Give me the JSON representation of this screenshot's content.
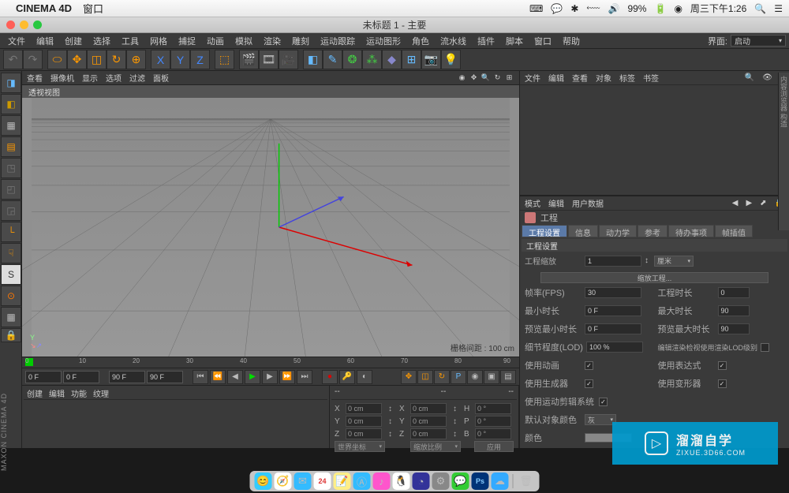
{
  "mac": {
    "app_name": "CINEMA 4D",
    "menus": [
      "窗口"
    ],
    "battery": "99%",
    "clock": "周三下午1:26"
  },
  "doc_title": "未标题 1 - 主要",
  "app_menus": [
    "文件",
    "编辑",
    "创建",
    "选择",
    "工具",
    "网格",
    "捕捉",
    "动画",
    "模拟",
    "渲染",
    "雕刻",
    "运动跟踪",
    "运动图形",
    "角色",
    "流水线",
    "插件",
    "脚本",
    "窗口",
    "帮助"
  ],
  "layout": {
    "label": "界面:",
    "value": "启动"
  },
  "viewport": {
    "menus": [
      "查看",
      "摄像机",
      "显示",
      "选项",
      "过滤",
      "面板"
    ],
    "label": "透视视图",
    "grid_dist": "栅格间距 : 100 cm",
    "axis_cube": "Y"
  },
  "timeline": {
    "ticks": [
      "0",
      "10",
      "20",
      "30",
      "40",
      "50",
      "60",
      "70",
      "80",
      "90"
    ],
    "fields": {
      "start": "0 F",
      "cur": "0 F",
      "preview_end": "90 F",
      "end": "90 F"
    }
  },
  "bottom": {
    "left_tabs": [
      "创建",
      "编辑",
      "功能",
      "纹理"
    ],
    "dash": "--",
    "coords": {
      "x": {
        "lbl": "X",
        "pos": "0 cm",
        "slbl": "X",
        "size": "0 cm",
        "hlbl": "H",
        "rot": "0 °"
      },
      "y": {
        "lbl": "Y",
        "pos": "0 cm",
        "slbl": "Y",
        "size": "0 cm",
        "plbl": "P",
        "rot": "0 °"
      },
      "z": {
        "lbl": "Z",
        "pos": "0 cm",
        "slbl": "Z",
        "size": "0 cm",
        "blbl": "B",
        "rot": "0 °"
      },
      "mode1": "世界坐标",
      "mode2": "缩放比例",
      "apply": "应用"
    }
  },
  "obj_panel": {
    "menus": [
      "文件",
      "编辑",
      "查看",
      "对象",
      "标签",
      "书签"
    ]
  },
  "attr_panel": {
    "menus": [
      "模式",
      "编辑",
      "用户数据"
    ],
    "title": "工程",
    "tabs": [
      "工程设置",
      "信息",
      "动力学",
      "参考",
      "待办事项",
      "帧插值"
    ],
    "section": "工程设置",
    "scale_lbl": "工程缩放",
    "scale_val": "1",
    "scale_unit": "厘米",
    "scale_btn": "缩放工程...",
    "fps_lbl": "帧率(FPS)",
    "fps_val": "30",
    "proj_time_lbl": "工程时长",
    "proj_time_val": "0",
    "min_time_lbl": "最小时长",
    "min_time_val": "0 F",
    "max_time_lbl": "最大时长",
    "max_time_val": "90",
    "prev_min_lbl": "预览最小时长",
    "prev_min_val": "0 F",
    "prev_max_lbl": "预览最大时长",
    "prev_max_val": "90",
    "lod_lbl": "细节程度(LOD)",
    "lod_val": "100 %",
    "lod_render_lbl": "编辑渲染检视使用渲染LOD级别",
    "use_anim_lbl": "使用动画",
    "use_expr_lbl": "使用表达式",
    "use_gen_lbl": "使用生成器",
    "use_deform_lbl": "使用变形器",
    "use_motion_lbl": "使用运动剪辑系统",
    "def_color_lbl": "默认对象颜色",
    "def_color_val": "灰",
    "color_lbl": "颜色"
  },
  "watermark": {
    "main": "溜溜自学",
    "sub": "ZIXUE.3D66.COM"
  },
  "brand": "MAXON CINEMA 4D"
}
